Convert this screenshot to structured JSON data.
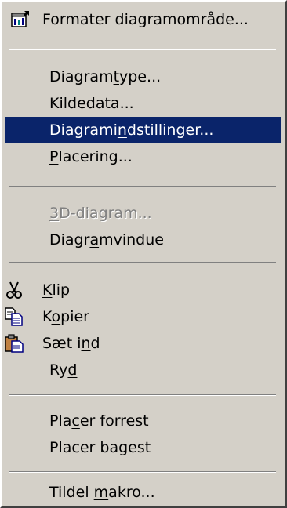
{
  "menu": {
    "items": [
      {
        "id": "format",
        "pre": "",
        "key": "F",
        "post": "ormater diagramområde..."
      },
      {
        "id": "type",
        "pre": "Diagram",
        "key": "t",
        "post": "ype..."
      },
      {
        "id": "source",
        "pre": "",
        "key": "K",
        "post": "ildedata..."
      },
      {
        "id": "options",
        "pre": "Diagrami",
        "key": "n",
        "post": "dstillinger..."
      },
      {
        "id": "location",
        "pre": "",
        "key": "P",
        "post": "lacering..."
      },
      {
        "id": "view3d",
        "pre": "",
        "key": "3",
        "post": "D-diagram..."
      },
      {
        "id": "window",
        "pre": "Diagr",
        "key": "a",
        "post": "mvindue"
      },
      {
        "id": "cut",
        "pre": "",
        "key": "K",
        "post": "lip"
      },
      {
        "id": "copy",
        "pre": "K",
        "key": "o",
        "post": "pier"
      },
      {
        "id": "paste",
        "pre": "Sæt i",
        "key": "n",
        "post": "d"
      },
      {
        "id": "clear",
        "pre": "Ry",
        "key": "d",
        "post": ""
      },
      {
        "id": "front",
        "pre": "Pla",
        "key": "c",
        "post": "er forrest"
      },
      {
        "id": "back",
        "pre": "Placer ",
        "key": "b",
        "post": "agest"
      },
      {
        "id": "macro",
        "pre": "Tildel ",
        "key": "m",
        "post": "akro..."
      }
    ],
    "highlighted": "options",
    "disabled": [
      "view3d"
    ]
  },
  "icons": {
    "format": "format-chart-area-icon",
    "cut": "scissors-icon",
    "copy": "copy-icon",
    "paste": "paste-clipboard-icon"
  },
  "colors": {
    "menu_bg": "#d4d0c8",
    "highlight_bg": "#0a246a",
    "highlight_text": "#ffffff",
    "disabled_text": "#808080"
  }
}
